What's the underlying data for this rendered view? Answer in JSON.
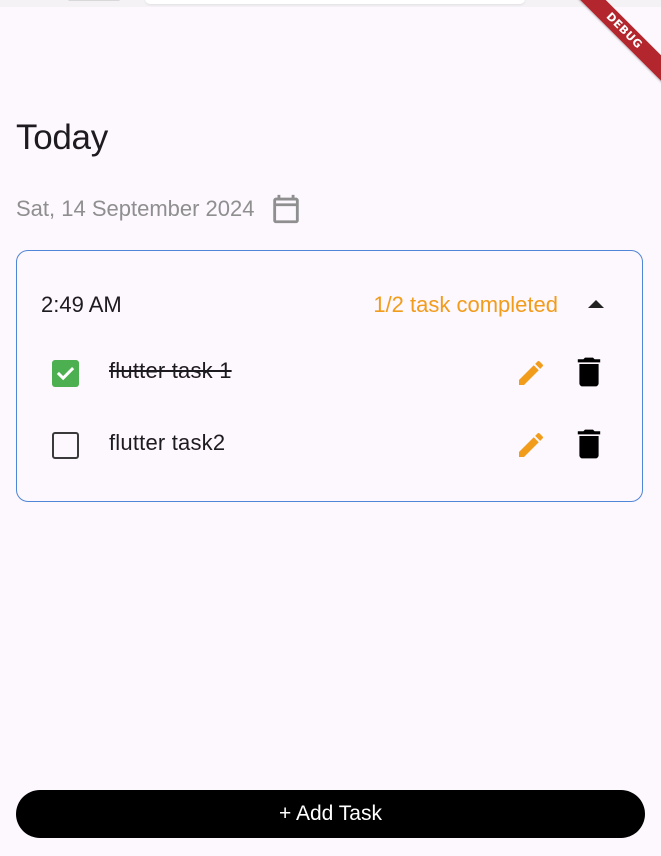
{
  "debug_banner": "DEBUG",
  "page": {
    "title": "Today",
    "date": "Sat, 14 September 2024"
  },
  "task_group": {
    "time": "2:49 AM",
    "progress": "1/2 task completed",
    "expanded": true,
    "tasks": [
      {
        "label": "flutter task 1",
        "completed": true
      },
      {
        "label": "flutter task2",
        "completed": false
      }
    ]
  },
  "actions": {
    "add_task_label": "+ Add Task"
  },
  "colors": {
    "background": "#fdf7fe",
    "accent_orange": "#f19c1b",
    "card_border": "#4f86d6",
    "checkbox_checked": "#4caf50",
    "debug_banner": "#b3262d",
    "button": "#000000"
  },
  "icons": {
    "calendar": "calendar-icon",
    "collapse": "chevron-up-icon",
    "edit": "pencil-icon",
    "delete": "trash-icon",
    "checked": "check-icon"
  }
}
